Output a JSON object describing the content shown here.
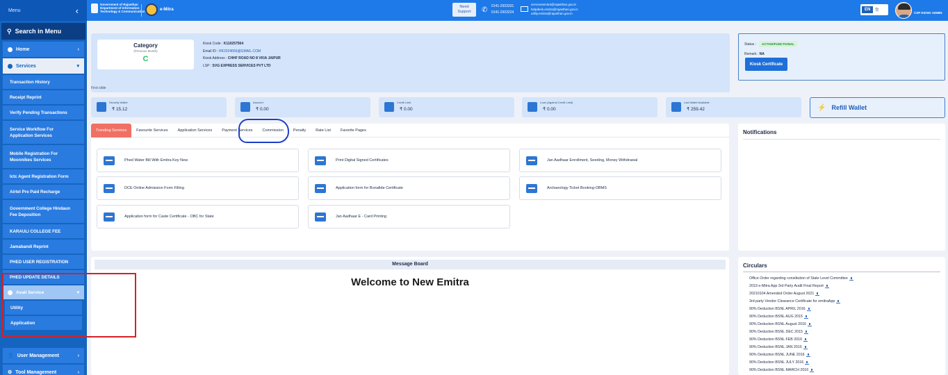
{
  "sidebar": {
    "title": "Menu",
    "search_label": "Search in Menu",
    "home": "Home",
    "services": "Services",
    "service_items": [
      "Transaction History",
      "Receipt Reprint",
      "Verify Pending Transactions",
      "Service Workflow For Application Services",
      "Mobile Registration For Moonnikes Services",
      "Ictc Agent Registration Form",
      "Airtel Pre Paid Recharge",
      "Government College Hindaun Fee Deposition",
      "KARAULI COLLEGE FEE",
      "Jamabandi Reprint",
      "PHED USER REGISTRATION",
      "PHED UPDATE DETAILS"
    ],
    "avail_service": "Avail Service",
    "avail_items": [
      "Utility",
      "Application"
    ],
    "user_management": "User Management",
    "tool_management": "Tool Management"
  },
  "topbar": {
    "gov_line1": "Government of Rajasthan",
    "gov_line2": "Department of Information",
    "gov_line3": "Technology & Communication",
    "emitra": "e-Mitra",
    "need_support_line1": "Need",
    "need_support_line2": "Support",
    "phone1": "0141-2923331",
    "phone2": "0141-2923224",
    "mail1": "servicesemitra@rajasthan.gov.in",
    "mail2": "helpdesk.emitra@rajasthan.gov.in",
    "mail3": "utility.emitra@rajasthan.gov.in",
    "lang_en": "EN",
    "lang_hi": "हि",
    "user_name": "CSP KIOSK ADMIN"
  },
  "kiosk": {
    "category_title": "Category",
    "category_sub": "(Previous Month)",
    "category_value": "C",
    "code_label": "Kiosk Code :",
    "code_value": "K110257564",
    "email_label": "Email ID :",
    "email_value": "RK2024666@GMAIL.COM",
    "address_label": "Kiosk Address :",
    "address_value": "CHHF ROAD NO 8 VKIA JAIPUR",
    "lsp_label": "LSP :",
    "lsp_value": "SVG EXPRESS SERVICES PVT LTD"
  },
  "status": {
    "status_label": "Status :",
    "status_value": "ACTIVE/FUNCTIONAL",
    "remark_label": "Remark :",
    "remark_value": "NA",
    "cert_button": "Kiosk Certificate"
  },
  "first_slide": "First slide",
  "wallets": [
    {
      "label": "Security Wallet",
      "value": "₹ 15.12"
    },
    {
      "label": "Assured",
      "value": "₹ 0.00"
    },
    {
      "label": "Credit Limit",
      "value": "₹ 0.00"
    },
    {
      "label": "Loan (Against Credit Limit)",
      "value": "₹ 0.00"
    },
    {
      "label": "Last Wallet Available",
      "value": "₹ 259.42"
    }
  ],
  "refill_label": "Refill Wallet",
  "tabs": [
    "Trending Services",
    "Favourite Services",
    "Application Services",
    "Payment Services",
    "Commission",
    "Penalty",
    "Rate List",
    "Favorite Pages"
  ],
  "services": [
    "Phed Water Bill With Emitra Key New",
    "Print Digital Signed Certificates",
    "Jan Aadhaar Enrollment, Seeding, Money Withdrawal",
    "DCE Online Admission Form Filling",
    "Application form for Bonafide Certificate",
    "Archaeology Ticket Booking-OBMS",
    "Application form for Caste Certificate - OBC for State",
    "Jan Aadhaar E - Card Printing"
  ],
  "notifications_title": "Notifications",
  "message_board": {
    "title": "Message Board",
    "welcome": "Welcome to New Emitra"
  },
  "circulars": {
    "title": "Circulars",
    "items": [
      "Office Order regarding constitution of State Level Committee",
      "2019 e-Mitra App 3rd Party Audit Final Report",
      "20210104 Amended Order August 2021",
      "3rd party Vendor Clearance Certificate for emitraApp",
      "90% Deduction BSNL APRIL 2016",
      "90% Deduction BSNL AUG 2015",
      "90% Deduction BSNL August 2016",
      "90% Deduction BSNL DEC 2015",
      "90% Deduction BSNL FEB 2016",
      "90% Deduction BSNL JAN 2016",
      "90% Deduction BSNL JUNE 2016",
      "90% Deduction BSNL JULY 2016",
      "90% Deduction BSNL MARCH 2016"
    ]
  }
}
